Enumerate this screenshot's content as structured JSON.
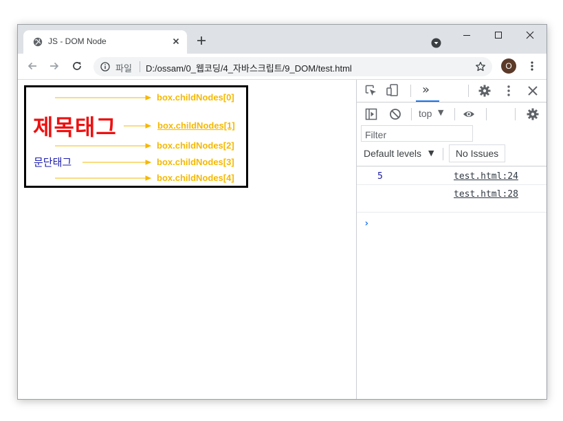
{
  "tab": {
    "title": "JS - DOM Node"
  },
  "address": {
    "scheme_label": "파일",
    "url": "D:/ossam/0_웹코딩/4_자바스크립트/9_DOM/test.html"
  },
  "profile": {
    "initial": "O"
  },
  "page": {
    "heading": "제목태그",
    "paragraph": "문단태그",
    "child_nodes": [
      "box.childNodes[0]",
      "box.childNodes[1]",
      "box.childNodes[2]",
      "box.childNodes[3]",
      "box.childNodes[4]"
    ],
    "colors": {
      "heading": "#ee1111",
      "paragraph": "#1a1ab0",
      "annotation": "#f5b800"
    }
  },
  "devtools": {
    "more_tabs": "»",
    "context": "top",
    "filter_placeholder": "Filter",
    "levels": "Default levels",
    "issues": "No Issues",
    "console": [
      {
        "value": "5",
        "source": "test.html:24"
      },
      {
        "value": "",
        "source": "test.html:28"
      }
    ],
    "prompt": "›"
  }
}
